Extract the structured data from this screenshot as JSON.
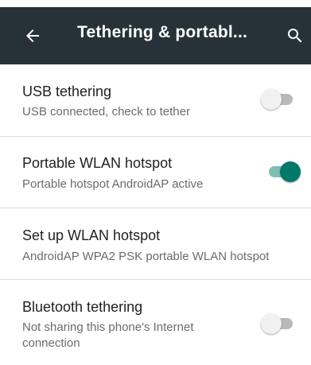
{
  "toolbar": {
    "title": "Tethering & portabl...",
    "back_icon": "arrow-back-icon",
    "search_icon": "search-icon",
    "background": "#263238"
  },
  "items": [
    {
      "title": "USB tethering",
      "summary": "USB connected, check to tether",
      "has_switch": true,
      "switch_on": false
    },
    {
      "title": "Portable WLAN hotspot",
      "summary": "Portable hotspot AndroidAP active",
      "has_switch": true,
      "switch_on": true
    },
    {
      "title": "Set up WLAN hotspot",
      "summary": "AndroidAP WPA2 PSK portable WLAN hotspot",
      "has_switch": false
    },
    {
      "title": "Bluetooth tethering",
      "summary": "Not sharing this phone's Internet connection",
      "has_switch": true,
      "switch_on": false
    }
  ],
  "colors": {
    "accent": "#00796b",
    "switch_off": "#b9b9b9"
  }
}
